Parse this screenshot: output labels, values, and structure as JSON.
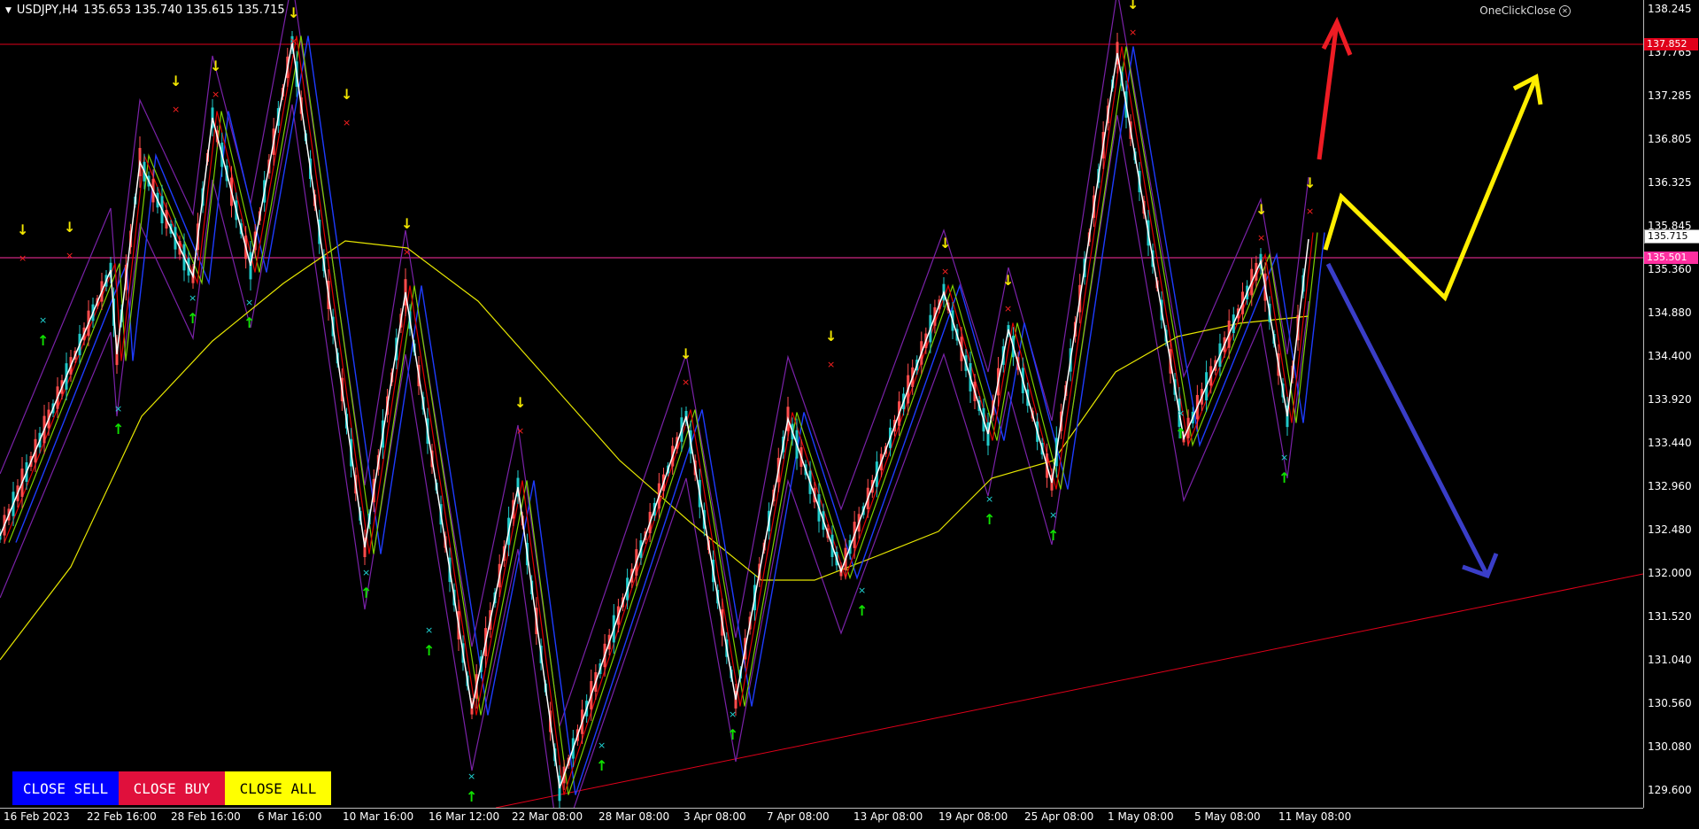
{
  "chart": {
    "symbol_info": "USDJPY,H4",
    "ohlc": "135.653 135.740 135.615 135.715",
    "oneclick_label": "OneClickClose",
    "price_axis": [
      "138.245",
      "137.765",
      "137.285",
      "136.805",
      "136.325",
      "135.845",
      "135.360",
      "134.880",
      "134.400",
      "133.920",
      "133.440",
      "132.960",
      "132.480",
      "132.000",
      "131.520",
      "131.040",
      "130.560",
      "130.080",
      "129.600"
    ],
    "price_tags": {
      "resistance": {
        "value": "137.852",
        "color": "#e0001a"
      },
      "current": {
        "value": "135.715",
        "color": "#ffffff"
      },
      "support": {
        "value": "135.501",
        "color": "#ff2fa0"
      }
    },
    "time_axis": [
      "16 Feb 2023",
      "22 Feb 16:00",
      "28 Feb 16:00",
      "6 Mar 16:00",
      "10 Mar 16:00",
      "16 Mar 12:00",
      "22 Mar 08:00",
      "28 Mar 08:00",
      "3 Apr 08:00",
      "7 Apr 08:00",
      "13 Apr 08:00",
      "19 Apr 08:00",
      "25 Apr 08:00",
      "1 May 08:00",
      "5 May 08:00",
      "11 May 08:00"
    ],
    "colors": {
      "up_candle": "#ff4c4c",
      "down_candle": "#20c9c9",
      "zigzag": "#ffffff",
      "ma_slow": "#e6e600",
      "ma_mid": "#1e3cff",
      "ma_fast": "#e00000",
      "ma_green": "#7cd000",
      "envelope": "#7a22a8",
      "arrow_up": "#10e000",
      "arrow_down": "#f2e600"
    }
  },
  "buttons": {
    "close_sell": {
      "label": "CLOSE SELL",
      "bg": "#0000ff",
      "fg": "#ffffff"
    },
    "close_buy": {
      "label": "CLOSE BUY",
      "bg": "#e0103c",
      "fg": "#ffffff"
    },
    "close_all": {
      "label": "CLOSE ALL",
      "bg": "#ffff00",
      "fg": "#000000"
    }
  },
  "annotations": {
    "red_arrow": "#ee1c24",
    "yellow_arrow": "#ffee00",
    "blue_arrow": "#3a3ec8"
  }
}
